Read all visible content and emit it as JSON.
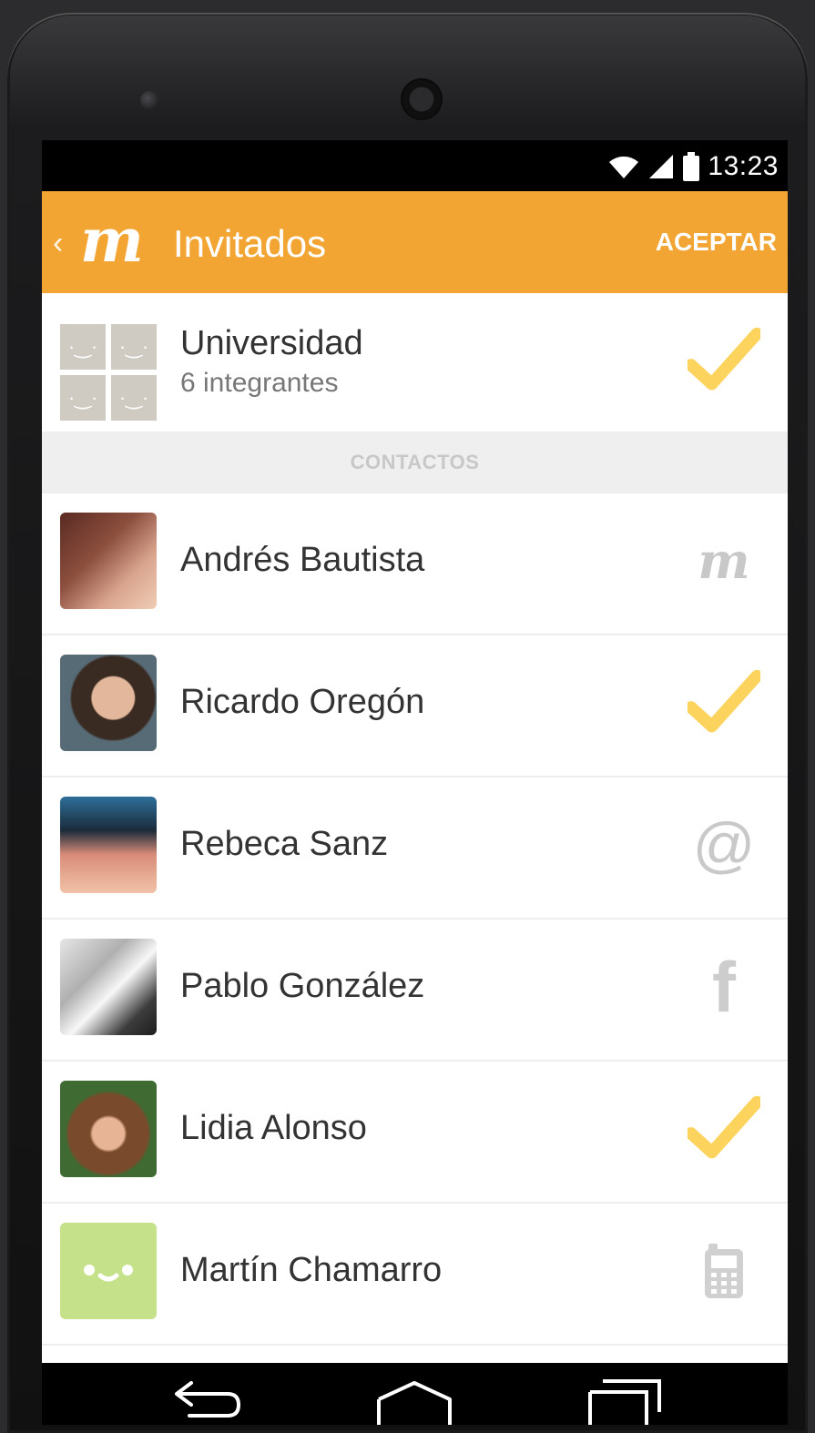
{
  "status": {
    "time": "13:23",
    "icons": [
      "wifi-icon",
      "signal-icon",
      "battery-icon"
    ]
  },
  "appbar": {
    "logo": "m",
    "title": "Invitados",
    "accept_label": "ACEPTAR"
  },
  "group": {
    "name": "Universidad",
    "subtitle": "6 integrantes",
    "status_icon": "check-icon"
  },
  "section_label": "CONTACTOS",
  "contacts": [
    {
      "name": "Andrés Bautista",
      "source_icon": "m-logo-icon"
    },
    {
      "name": "Ricardo Oregón",
      "source_icon": "check-icon"
    },
    {
      "name": "Rebeca Sanz",
      "source_icon": "at-icon"
    },
    {
      "name": "Pablo González",
      "source_icon": "facebook-icon"
    },
    {
      "name": "Lidia Alonso",
      "source_icon": "check-icon"
    },
    {
      "name": "Martín Chamarro",
      "source_icon": "phone-icon"
    }
  ],
  "icon_glyphs": {
    "m": "m",
    "at": "@",
    "facebook": "f"
  },
  "colors": {
    "accent": "#f3a534",
    "check": "#fcd35c",
    "placeholder_avatar": "#c5e28a"
  }
}
